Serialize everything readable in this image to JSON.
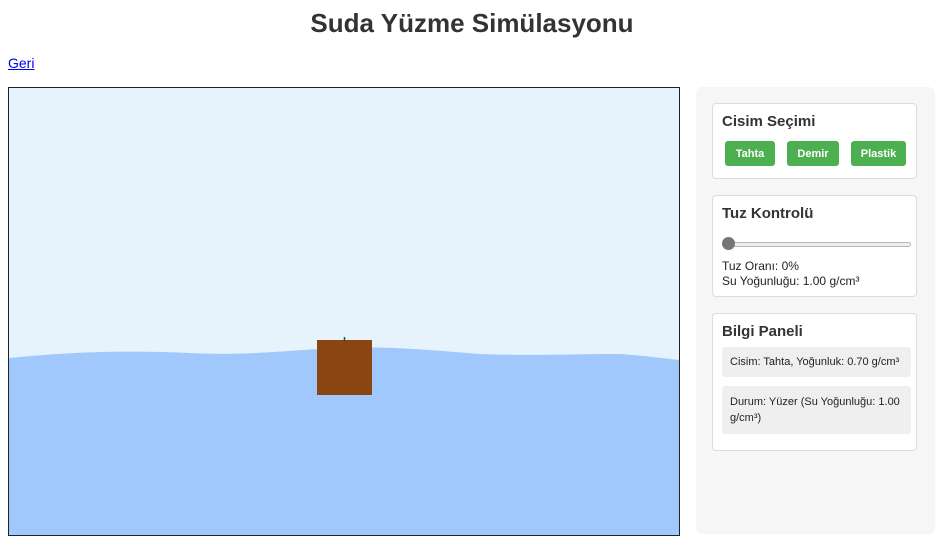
{
  "page": {
    "title": "Suda Yüzme Simülasyonu",
    "back_link": "Geri"
  },
  "simulation": {
    "water_color": "#a0c8fc",
    "sky_color": "#e6f2fc",
    "object_color": "#8b4513"
  },
  "object_selection": {
    "heading": "Cisim Seçimi",
    "buttons": [
      "Tahta",
      "Demir",
      "Plastik"
    ],
    "button_color": "#4caf50"
  },
  "salt_control": {
    "heading": "Tuz Kontrolü",
    "slider_value": 0,
    "salt_ratio_text": "Tuz Oranı: 0%",
    "water_density_text": "Su Yoğunluğu: 1.00 g/cm³"
  },
  "info_panel": {
    "heading": "Bilgi Paneli",
    "object_info": "Cisim: Tahta, Yoğunluk: 0.70 g/cm³",
    "status_info": "Durum: Yüzer (Su Yoğunluğu: 1.00 g/cm³)"
  }
}
